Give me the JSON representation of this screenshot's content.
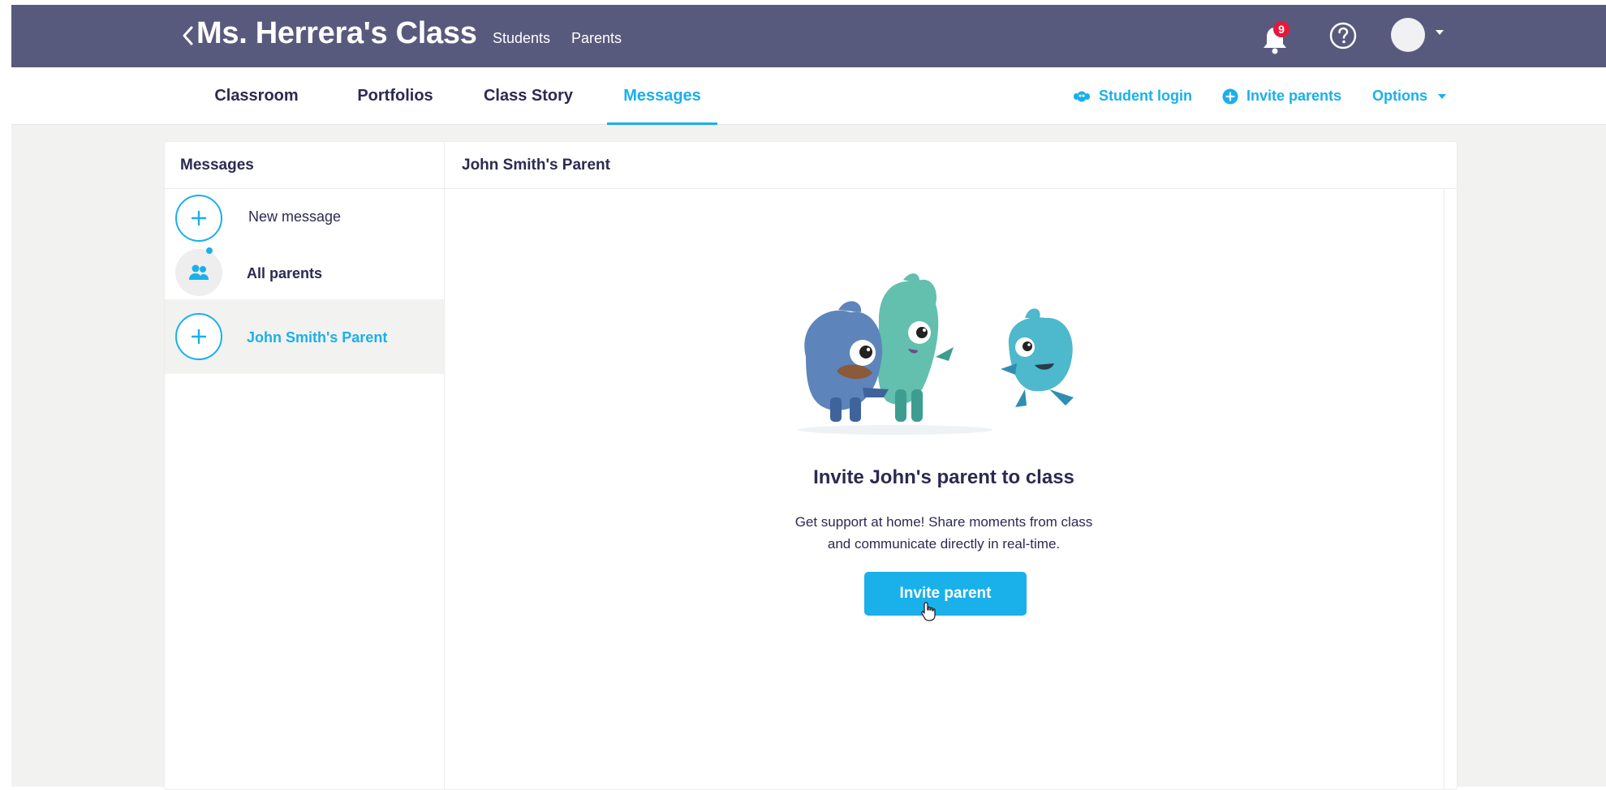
{
  "header": {
    "back_icon": "chevron-left-icon",
    "class_title": "Ms. Herrera's Class",
    "students_link": "Students",
    "parents_link": "Parents",
    "notifications_count": "9",
    "notifications_icon": "bell-icon",
    "help_icon": "help-icon",
    "avatar_icon": "avatar",
    "bar_color": "#585a7d"
  },
  "nav": {
    "tabs": [
      {
        "label": "Classroom"
      },
      {
        "label": "Portfolios"
      },
      {
        "label": "Class Story"
      },
      {
        "label": "Messages",
        "active": true
      }
    ],
    "student_login": "Student login",
    "invite_parents": "Invite parents",
    "options": "Options",
    "accent_color": "#1ab0ea"
  },
  "messages_panel": {
    "title": "Messages",
    "items": [
      {
        "label": "New message",
        "icon": "plus-icon"
      },
      {
        "label": "All parents",
        "icon": "group-icon"
      },
      {
        "label": "John Smith's Parent",
        "icon": "plus-icon",
        "selected": true
      }
    ]
  },
  "conversation": {
    "title": "John Smith's Parent",
    "empty_title": "Invite John's parent to class",
    "empty_text_line1": "Get support at home! Share moments from class",
    "empty_text_line2": "and communicate directly in real-time.",
    "invite_button": "Invite parent"
  }
}
